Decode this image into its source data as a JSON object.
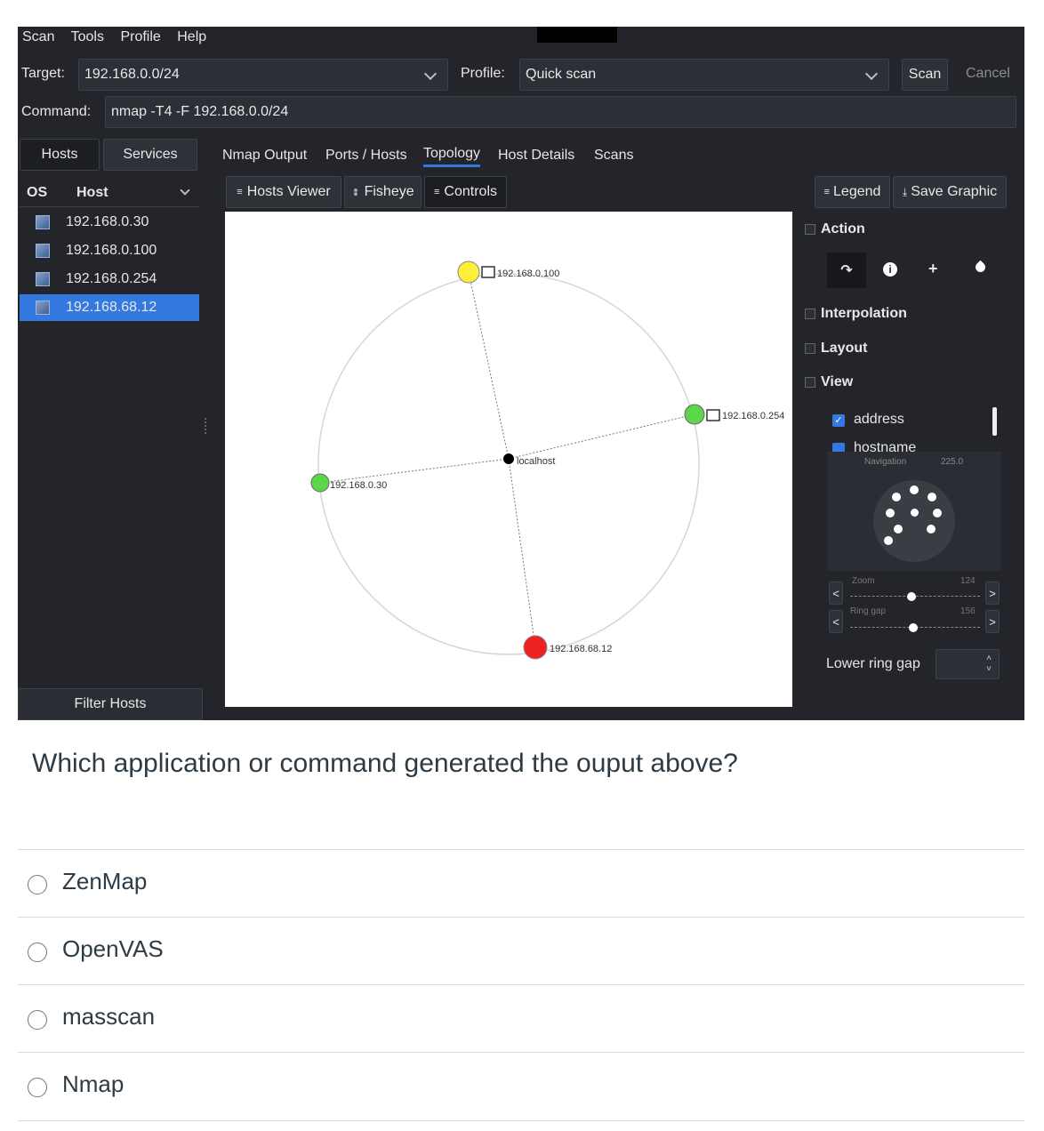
{
  "menu": [
    "Scan",
    "Tools",
    "Profile",
    "Help"
  ],
  "target": {
    "label": "Target:",
    "value": "192.168.0.0/24"
  },
  "profile": {
    "label": "Profile:",
    "value": "Quick scan"
  },
  "scan_button": "Scan",
  "cancel_button": "Cancel",
  "command": {
    "label": "Command:",
    "value": "nmap -T4 -F 192.168.0.0/24"
  },
  "left_tabs": [
    "Hosts",
    "Services"
  ],
  "host_list": {
    "col_os": "OS",
    "col_host": "Host",
    "hosts": [
      "192.168.0.30",
      "192.168.0.100",
      "192.168.0.254",
      "192.168.68.12"
    ],
    "selected_index": 3
  },
  "filter_button": "Filter Hosts",
  "main_tabs": [
    "Nmap Output",
    "Ports / Hosts",
    "Topology",
    "Host Details",
    "Scans"
  ],
  "active_tab": "Topology",
  "toolbar": {
    "hosts_viewer": "Hosts Viewer",
    "fisheye": "Fisheye",
    "controls": "Controls",
    "legend": "Legend",
    "save_graphic": "Save Graphic"
  },
  "topology": {
    "center": "localhost",
    "nodes": [
      {
        "label": "192.168.0.100",
        "color": "#ffee3a"
      },
      {
        "label": "192.168.0.254",
        "color": "#5cd64a"
      },
      {
        "label": "192.168.0.30",
        "color": "#5cd64a"
      },
      {
        "label": "192.168.68.12",
        "color": "#ee2222"
      }
    ]
  },
  "controls": {
    "action": "Action",
    "interpolation": "Interpolation",
    "layout": "Layout",
    "view": "View",
    "view_address": "address",
    "view_hostname": "hostname",
    "navigation": "Navigation",
    "navigation_value": "225.0",
    "zoom": "Zoom",
    "zoom_value": "124",
    "ring_gap": "Ring gap",
    "ring_gap_value": "156",
    "lower_ring_gap": "Lower ring gap"
  },
  "quiz": {
    "question": "Which application or command generated the ouput above?",
    "options": [
      "ZenMap",
      "OpenVAS",
      "masscan",
      "Nmap"
    ]
  }
}
